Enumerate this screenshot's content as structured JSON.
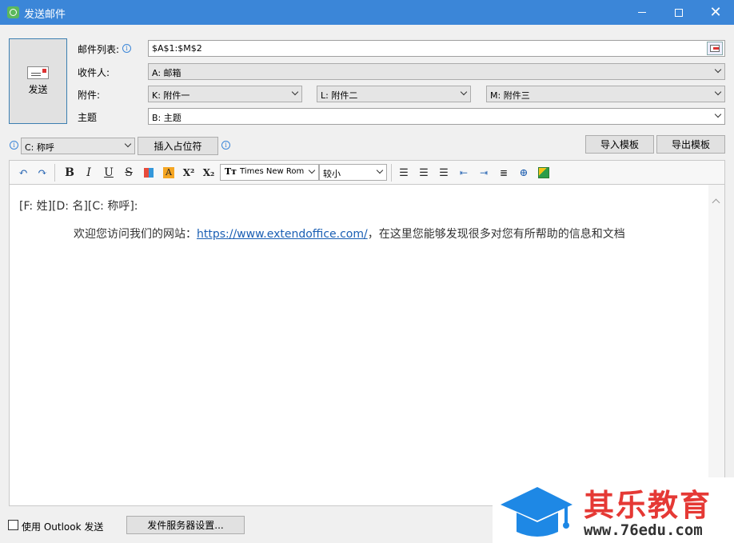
{
  "window": {
    "title": "发送邮件"
  },
  "send_button": {
    "label": "发送"
  },
  "fields": {
    "mail_list_label": "邮件列表:",
    "mail_list_value": "$A$1:$M$2",
    "recipient_label": "收件人:",
    "recipient_value": "A: 邮箱",
    "attachment_label": "附件:",
    "attachment_values": [
      "K: 附件一",
      "L: 附件二",
      "M: 附件三"
    ],
    "subject_label": "主题",
    "subject_value": "B: 主题"
  },
  "placeholder_bar": {
    "placeholder_value": "C: 称呼",
    "insert_button": "插入占位符",
    "import_button": "导入模板",
    "export_button": "导出模板"
  },
  "toolbar": {
    "font_name": "Times New Rom",
    "font_size": "较小"
  },
  "editor": {
    "line1": "[F: 姓][D: 名][C: 称呼]:",
    "line2_prefix": "欢迎您访问我们的网站：",
    "line2_link": "https://www.extendoffice.com/",
    "line2_suffix": "，在这里您能够发现很多对您有所帮助的信息和文档"
  },
  "bottom": {
    "outlook_label": "使用 Outlook 发送",
    "server_button": "发件服务器设置..."
  },
  "watermark": {
    "title": "其乐教育",
    "url": "www.76edu.com"
  },
  "colors": {
    "titlebar": "#3b86d8",
    "link": "#1a5fb4",
    "watermark_red": "#e53935",
    "watermark_blue": "#1e88e5"
  }
}
